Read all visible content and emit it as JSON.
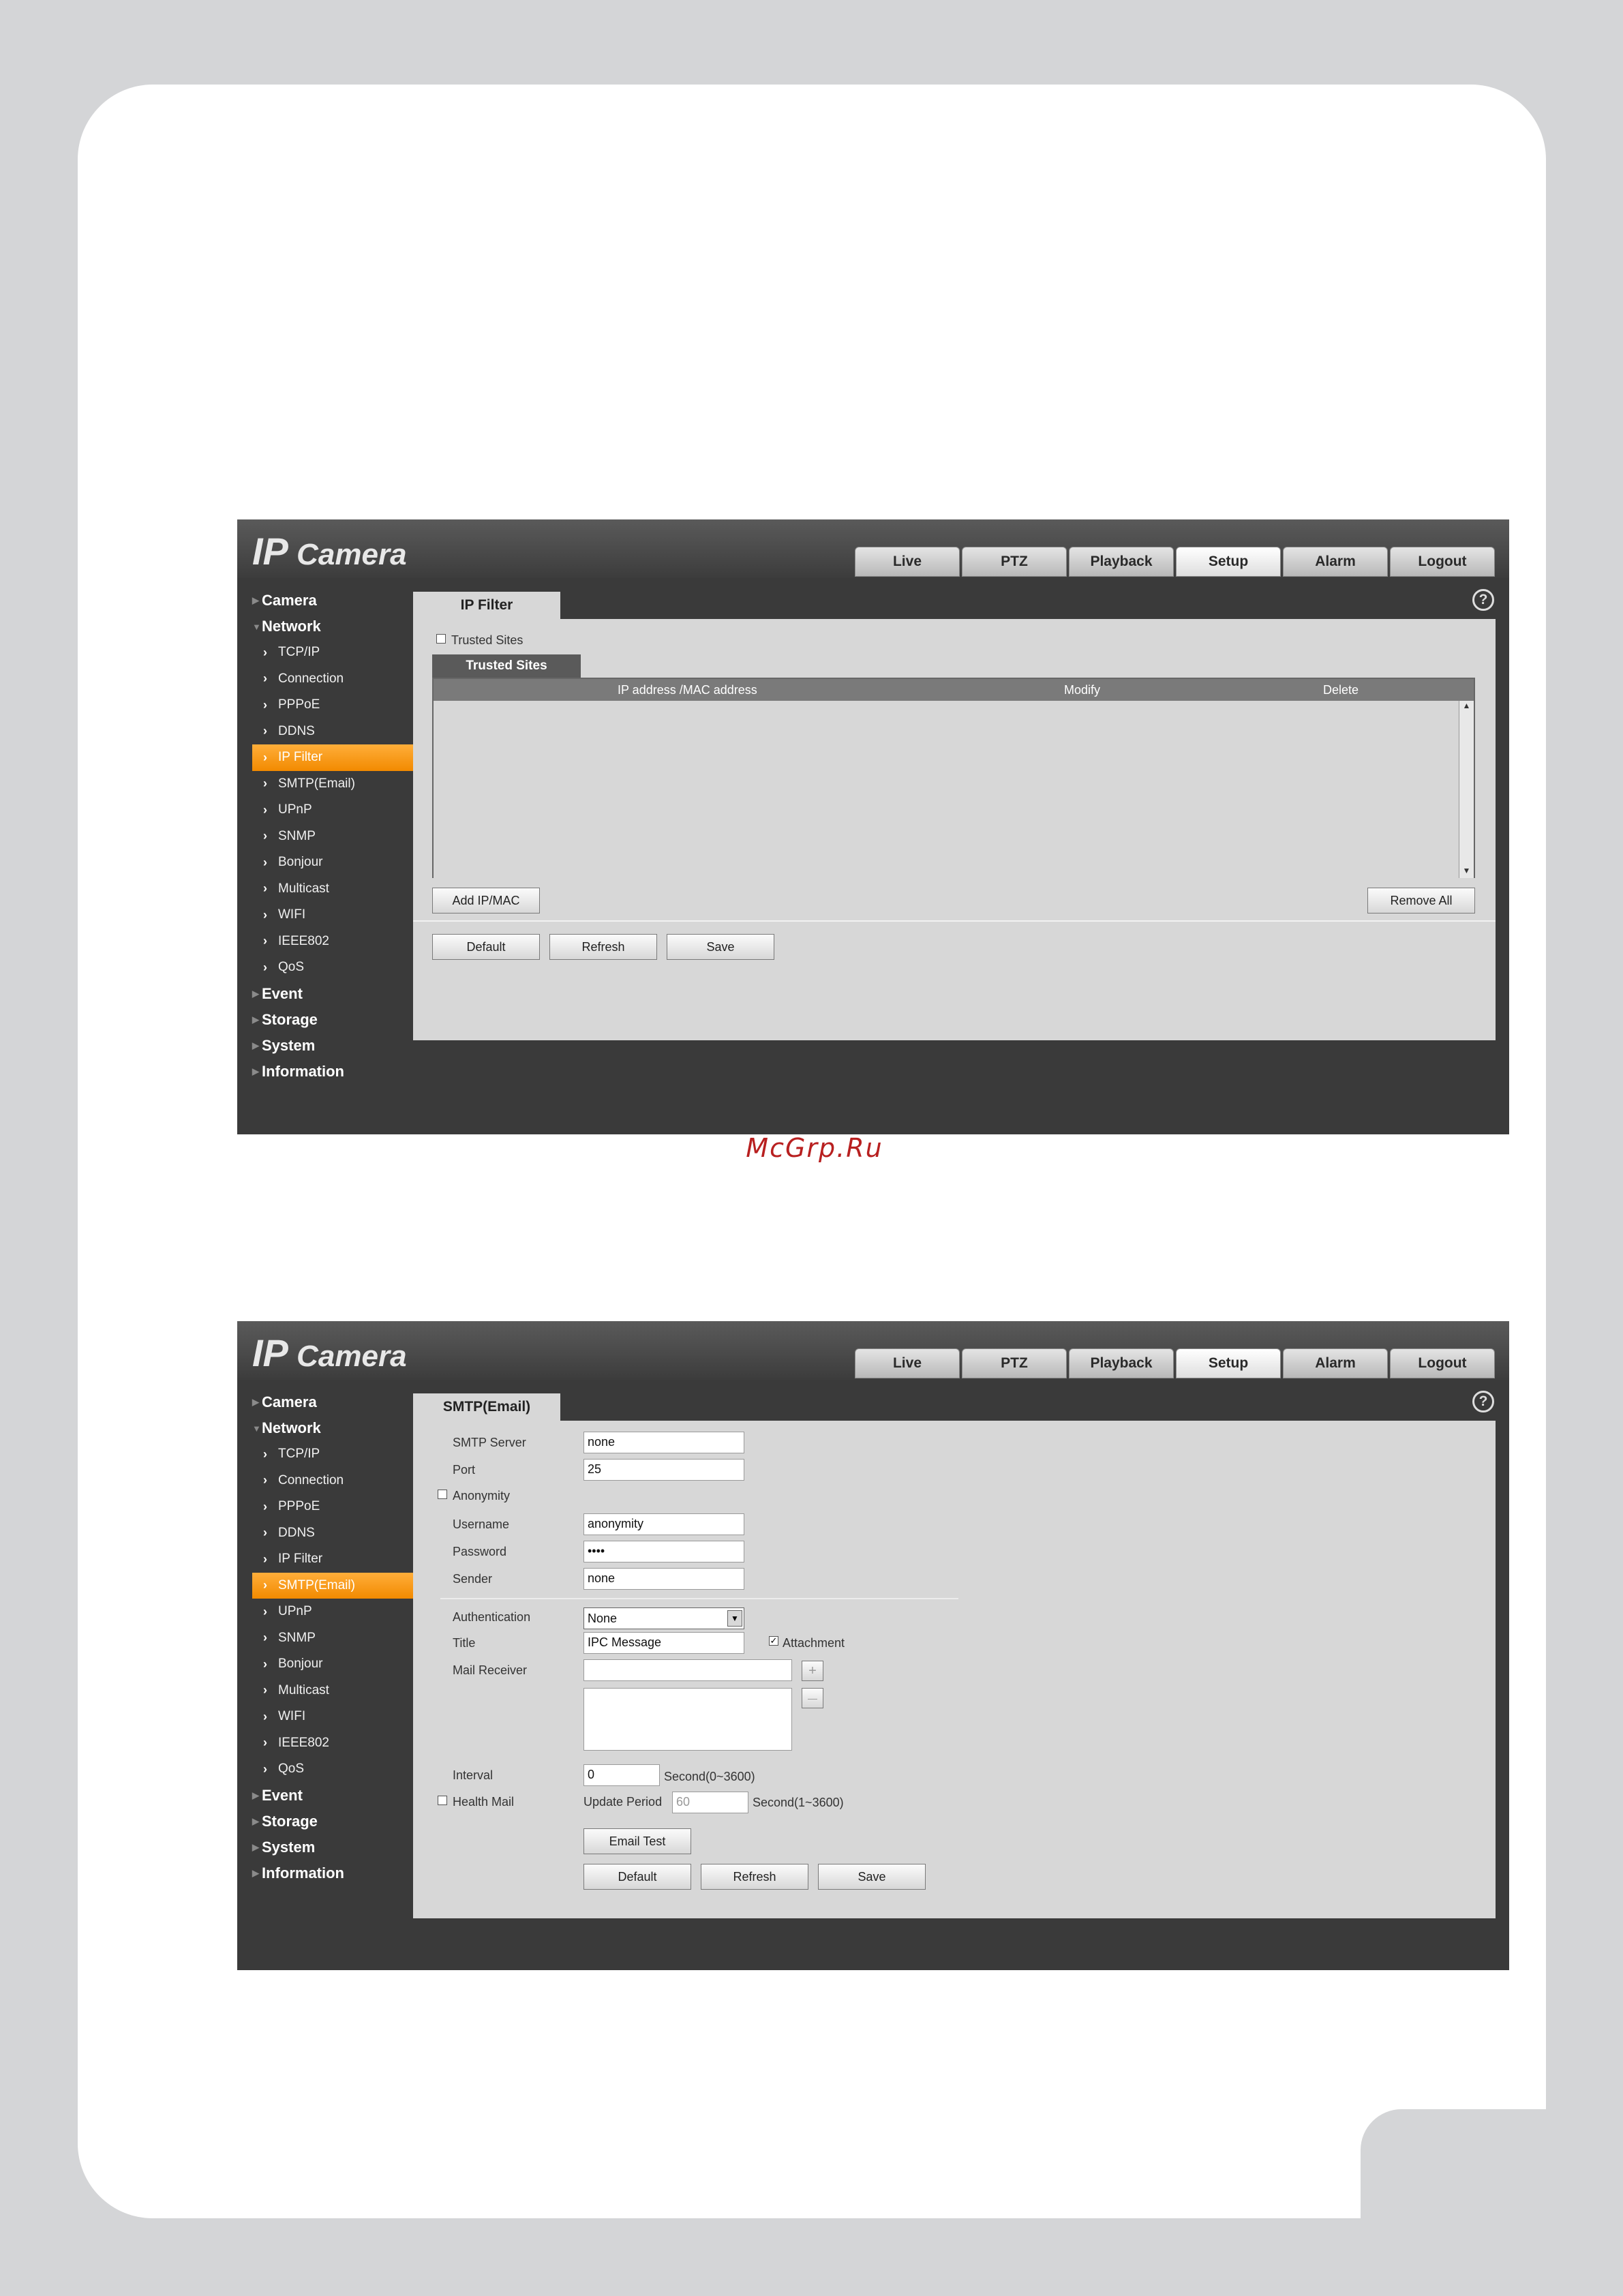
{
  "watermark": "McGrp.Ru",
  "screenshot1": {
    "logo_ip": "IP",
    "logo_camera": " Camera",
    "tabs": [
      "Live",
      "PTZ",
      "Playback",
      "Setup",
      "Alarm",
      "Logout"
    ],
    "sidebar": {
      "camera": "Camera",
      "network": "Network",
      "items": [
        "TCP/IP",
        "Connection",
        "PPPoE",
        "DDNS",
        "IP Filter",
        "SMTP(Email)",
        "UPnP",
        "SNMP",
        "Bonjour",
        "Multicast",
        "WIFI",
        "IEEE802",
        "QoS"
      ],
      "event": "Event",
      "storage": "Storage",
      "system": "System",
      "information": "Information"
    },
    "page_tab": "IP Filter",
    "trusted_sites_checkbox": "Trusted Sites",
    "sub_tab": "Trusted Sites",
    "table_headers": [
      "IP address /MAC address",
      "Modify",
      "Delete"
    ],
    "add_button": "Add IP/MAC",
    "remove_all_button": "Remove All",
    "default_button": "Default",
    "refresh_button": "Refresh",
    "save_button": "Save"
  },
  "screenshot2": {
    "logo_ip": "IP",
    "logo_camera": " Camera",
    "tabs": [
      "Live",
      "PTZ",
      "Playback",
      "Setup",
      "Alarm",
      "Logout"
    ],
    "sidebar": {
      "camera": "Camera",
      "network": "Network",
      "items": [
        "TCP/IP",
        "Connection",
        "PPPoE",
        "DDNS",
        "IP Filter",
        "SMTP(Email)",
        "UPnP",
        "SNMP",
        "Bonjour",
        "Multicast",
        "WIFI",
        "IEEE802",
        "QoS"
      ],
      "event": "Event",
      "storage": "Storage",
      "system": "System",
      "information": "Information"
    },
    "page_tab": "SMTP(Email)",
    "form": {
      "smtp_server_label": "SMTP Server",
      "smtp_server_value": "none",
      "port_label": "Port",
      "port_value": "25",
      "anonymity_label": "Anonymity",
      "username_label": "Username",
      "username_value": "anonymity",
      "password_label": "Password",
      "password_value": "••••",
      "sender_label": "Sender",
      "sender_value": "none",
      "authentication_label": "Authentication",
      "authentication_value": "None",
      "title_label": "Title",
      "title_value": "IPC Message",
      "attachment_label": "Attachment",
      "mail_receiver_label": "Mail Receiver",
      "add_symbol": "+",
      "remove_symbol": "—",
      "interval_label": "Interval",
      "interval_value": "0",
      "interval_unit": "Second(0~3600)",
      "health_mail_label": "Health Mail",
      "update_period_label": "Update Period",
      "update_period_value": "60",
      "update_period_unit": "Second(1~3600)"
    },
    "email_test_button": "Email Test",
    "default_button": "Default",
    "refresh_button": "Refresh",
    "save_button": "Save"
  }
}
